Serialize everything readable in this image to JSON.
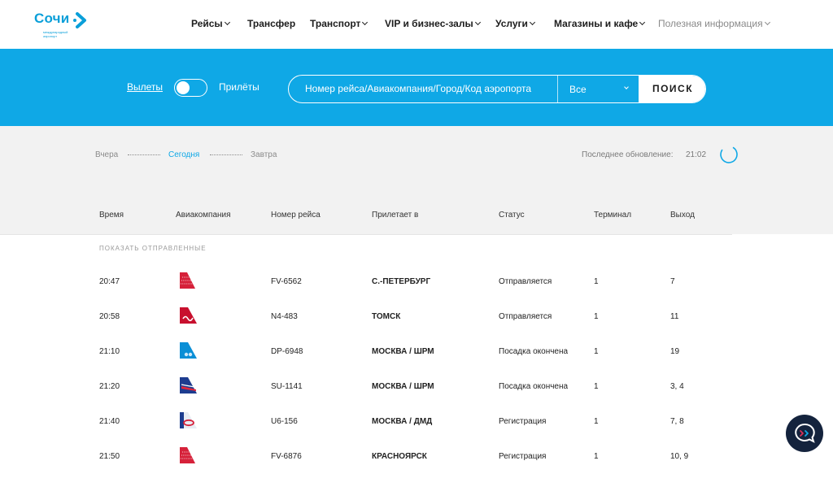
{
  "header": {
    "logo_word": "Сочи",
    "logo_sub": "международный аэропорт",
    "nav": [
      {
        "label": "Рейсы",
        "dropdown": true,
        "muted": false
      },
      {
        "label": "Трансфер",
        "dropdown": false,
        "muted": false
      },
      {
        "label": "Транспорт",
        "dropdown": true,
        "muted": false
      },
      {
        "label": "VIP и бизнес-залы",
        "dropdown": true,
        "muted": false
      },
      {
        "label": "Услуги",
        "dropdown": true,
        "muted": false
      },
      {
        "label": "Магазины и кафе",
        "dropdown": true,
        "muted": false
      },
      {
        "label": "Полезная информация",
        "dropdown": true,
        "muted": true
      }
    ]
  },
  "search": {
    "departures_label": "Вылеты",
    "arrivals_label": "Прилёты",
    "placeholder": "Номер рейса/Авиакомпания/Город/Код аэропорта",
    "filter_value": "Все",
    "button_label": "ПОИСК"
  },
  "board": {
    "days": {
      "yesterday": "Вчера",
      "today": "Сегодня",
      "tomorrow": "Завтра"
    },
    "last_update_label": "Последнее обновление:",
    "last_update_time": "21:02",
    "columns": {
      "time": "Время",
      "airline": "Авиакомпания",
      "flight": "Номер рейса",
      "destination": "Прилетает в",
      "status": "Статус",
      "terminal": "Терминал",
      "gate": "Выход"
    },
    "show_departed": "ПОКАЗАТЬ ОТПРАВЛЕННЫЕ",
    "flights": [
      {
        "time": "20:47",
        "airline_icon": "rossiya-airline-icon",
        "flight": "FV-6562",
        "destination": "С.-ПЕТЕРБУРГ",
        "status": "Отправляется",
        "terminal": "1",
        "gate": "7"
      },
      {
        "time": "20:58",
        "airline_icon": "nordstar-airline-icon",
        "flight": "N4-483",
        "destination": "ТОМСК",
        "status": "Отправляется",
        "terminal": "1",
        "gate": "11"
      },
      {
        "time": "21:10",
        "airline_icon": "pobeda-airline-icon",
        "flight": "DP-6948",
        "destination": "МОСКВА / ШРМ",
        "status": "Посадка окончена",
        "terminal": "1",
        "gate": "19"
      },
      {
        "time": "21:20",
        "airline_icon": "aeroflot-airline-icon",
        "flight": "SU-1141",
        "destination": "МОСКВА / ШРМ",
        "status": "Посадка окончена",
        "terminal": "1",
        "gate": "3, 4"
      },
      {
        "time": "21:40",
        "airline_icon": "ural-airlines-icon",
        "flight": "U6-156",
        "destination": "МОСКВА / ДМД",
        "status": "Регистрация",
        "terminal": "1",
        "gate": "7, 8"
      },
      {
        "time": "21:50",
        "airline_icon": "rossiya-airline-icon",
        "flight": "FV-6876",
        "destination": "КРАСНОЯРСК",
        "status": "Регистрация",
        "terminal": "1",
        "gate": "10, 9"
      }
    ]
  },
  "colors": {
    "accent": "#0fa8e6",
    "logo": "#0a9fd9",
    "chat": "#14233d"
  }
}
